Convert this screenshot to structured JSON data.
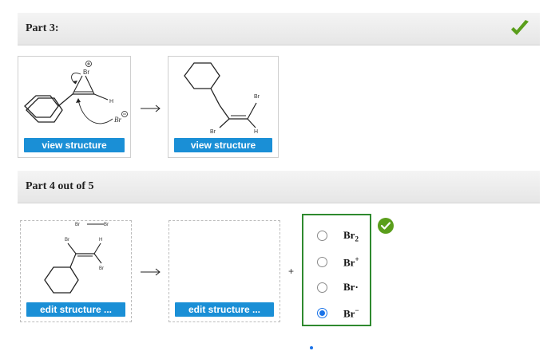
{
  "part3": {
    "title": "Part 3:"
  },
  "part4": {
    "title": "Part 4 out of 5"
  },
  "view_structure_label": "view structure",
  "edit_structure_label": "edit structure ...",
  "plus_sign": "+",
  "molecule_labels": {
    "bromonium_br": "Br",
    "bromonium_charge": "⊕",
    "h": "H",
    "bromide_br": "Br",
    "bromide_charge": "⊖",
    "product_br_top": "Br",
    "product_br_bottom": "Br",
    "product_h": "H",
    "br2_left": "Br",
    "br2_right": "Br",
    "reactant_br": "Br",
    "reactant_h": "H",
    "reactant_br2": "Br"
  },
  "options": [
    {
      "base": "Br",
      "sub": "2",
      "sup": "",
      "selected": false
    },
    {
      "base": "Br",
      "sub": "",
      "sup": "+",
      "selected": false
    },
    {
      "base": "Br·",
      "sub": "",
      "sup": "",
      "selected": false
    },
    {
      "base": "Br",
      "sub": "",
      "sup": "−",
      "selected": true
    }
  ],
  "colors": {
    "check_green": "#5a9e1b",
    "button_blue": "#1a8fd6",
    "answer_border": "#2f8a2f"
  },
  "icons": {
    "part3_status": "checkmark-icon",
    "answer_status": "check-circle-icon"
  }
}
